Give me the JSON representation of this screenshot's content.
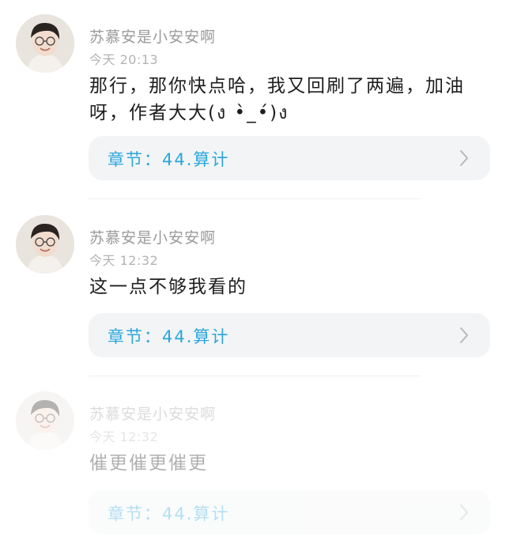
{
  "colors": {
    "accent": "#2aa6dd",
    "username": "#9a9a9a",
    "time": "#b3b3b3",
    "text": "#1e1e1e",
    "card_bg": "#f3f4f6"
  },
  "comments": [
    {
      "username": "苏慕安是小安安啊",
      "time": "今天 20:13",
      "text": "那行，那你快点哈，我又回刷了两遍，加油呀，作者大大(ง •̀_•́)ง",
      "chapter_label": "章节：44.算计",
      "avatar_icon": "user-avatar",
      "chevron_icon": "chevron-right-icon"
    },
    {
      "username": "苏慕安是小安安啊",
      "time": "今天 12:32",
      "text": "这一点不够我看的",
      "chapter_label": "章节：44.算计",
      "avatar_icon": "user-avatar",
      "chevron_icon": "chevron-right-icon"
    },
    {
      "username": "苏慕安是小安安啊",
      "time": "今天 12:32",
      "text": "催更催更催更",
      "chapter_label": "章节：44.算计",
      "avatar_icon": "user-avatar",
      "chevron_icon": "chevron-right-icon"
    }
  ]
}
